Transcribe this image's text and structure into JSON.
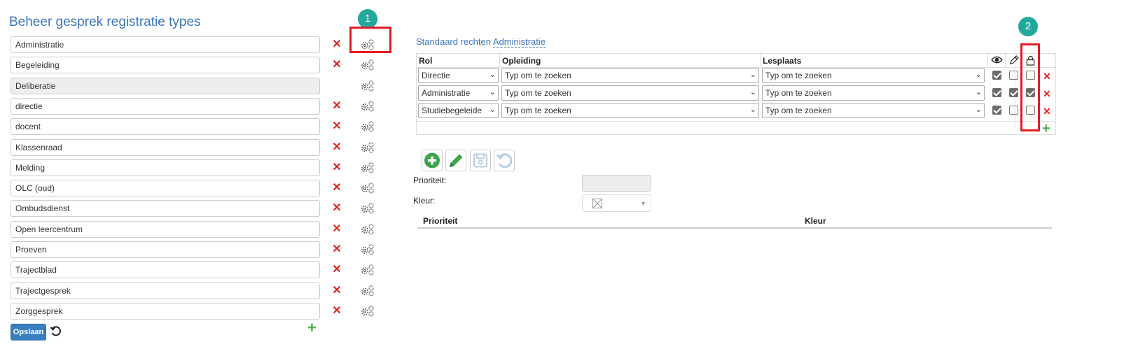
{
  "left_panel": {
    "title": "Beheer gesprek registratie types",
    "types": [
      {
        "label": "Administratie",
        "deletable": true
      },
      {
        "label": "Begeleiding",
        "deletable": true
      },
      {
        "label": "Deliberatie",
        "deletable": false,
        "disabled": true
      },
      {
        "label": "directie",
        "deletable": true
      },
      {
        "label": "docent",
        "deletable": true
      },
      {
        "label": "Klassenraad",
        "deletable": true
      },
      {
        "label": "Melding",
        "deletable": true
      },
      {
        "label": "OLC (oud)",
        "deletable": true
      },
      {
        "label": "Ombudsdienst",
        "deletable": true
      },
      {
        "label": "Open leercentrum",
        "deletable": true
      },
      {
        "label": "Proeven",
        "deletable": true
      },
      {
        "label": "Trajectblad",
        "deletable": true
      },
      {
        "label": "Trajectgesprek",
        "deletable": true
      },
      {
        "label": "Zorggesprek",
        "deletable": true
      }
    ],
    "delete_icon": "close-icon",
    "settings_icon": "gears-icon",
    "save_label": "Opslaan",
    "undo_icon": "undo-icon",
    "add_icon": "plus-icon"
  },
  "annotations": {
    "badge1": "1",
    "badge2": "2",
    "badge_color": "#24a89b",
    "highlight_color": "#e31b23"
  },
  "right_panel": {
    "title_prefix": "Standaard rechten",
    "title_link": "Administratie",
    "table": {
      "headers": {
        "rol": "Rol",
        "opleiding": "Opleiding",
        "lesplaats": "Lesplaats"
      },
      "header_icons": [
        "eye-icon",
        "pencil-icon",
        "lock-icon"
      ],
      "rows": [
        {
          "rol": "Directie",
          "opleiding": "Typ om te zoeken",
          "lesplaats": "Typ om te zoeken",
          "view": true,
          "edit": false,
          "lock": false
        },
        {
          "rol": "Administratie",
          "opleiding": "Typ om te zoeken",
          "lesplaats": "Typ om te zoeken",
          "view": true,
          "edit": true,
          "lock": true
        },
        {
          "rol": "Studiebegeleide",
          "opleiding": "Typ om te zoeken",
          "lesplaats": "Typ om te zoeken",
          "view": true,
          "edit": false,
          "lock": false
        }
      ]
    },
    "toolbar_icons": [
      "add-circle-icon",
      "edit-icon",
      "save-icon",
      "undo-icon"
    ],
    "form": {
      "prioriteit_label": "Prioriteit:",
      "kleur_label": "Kleur:",
      "prioriteit_value": "",
      "kleur_value_icon": "empty-color-icon"
    },
    "list_headers": {
      "prioriteit": "Prioriteit",
      "kleur": "Kleur"
    }
  },
  "colors": {
    "title_blue": "#3a78b8",
    "delete_red": "#e02020",
    "add_green": "#4cae4c",
    "primary_button": "#3a7ec2"
  }
}
